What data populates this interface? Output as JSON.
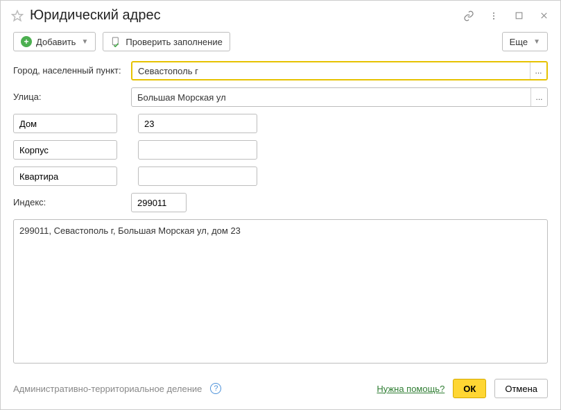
{
  "title": "Юридический адрес",
  "toolbar": {
    "add_label": "Добавить",
    "check_label": "Проверить заполнение",
    "more_label": "Еще"
  },
  "form": {
    "city_label": "Город, населенный пункт:",
    "city_value": "Севастополь г",
    "street_label": "Улица:",
    "street_value": "Большая Морская ул",
    "house_type": "Дом",
    "house_value": "23",
    "korpus_type": "Корпус",
    "korpus_value": "",
    "flat_type": "Квартира",
    "flat_value": "",
    "index_label": "Индекс:",
    "index_value": "299011",
    "full_address": "299011, Севастополь г, Большая Морская ул, дом 23"
  },
  "footer": {
    "admin_div": "Административно-территориальное деление",
    "need_help": "Нужна помощь?",
    "ok": "ОК",
    "cancel": "Отмена"
  }
}
